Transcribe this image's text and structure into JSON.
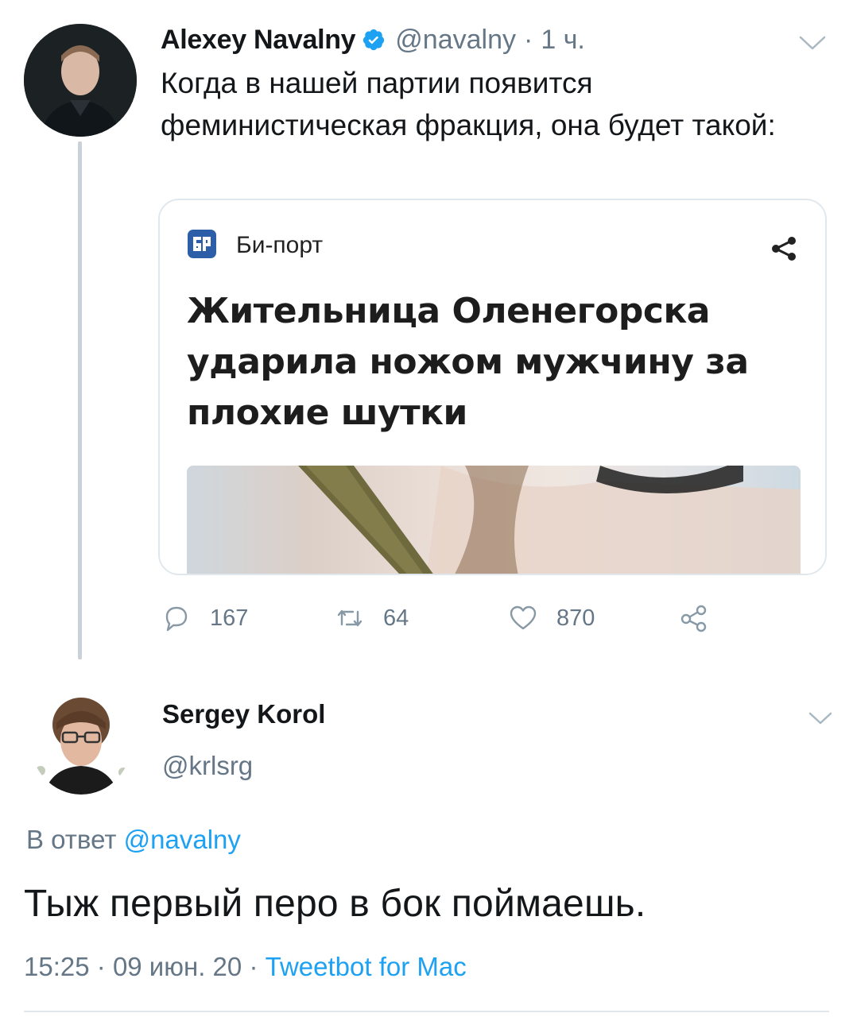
{
  "tweet": {
    "author_name": "Alexey Navalny",
    "author_handle": "@navalny",
    "separator": "·",
    "time_ago": "1 ч.",
    "text": "Когда в нашей партии появится феминистическая фракция, она будет такой:",
    "card": {
      "source": "Би-порт",
      "headline": "Жительница Оленегорска ударила ножом мужчину за плохие шутки"
    },
    "stats": {
      "replies": "167",
      "retweets": "64",
      "likes": "870"
    }
  },
  "reply": {
    "author_name": "Sergey Korol",
    "author_handle": "@krlsrg",
    "reply_prefix": "В ответ",
    "reply_to_handle": "@navalny",
    "text": "Тыж первый перо в бок поймаешь.",
    "time": "15:25",
    "separator": "·",
    "date": "09 июн. 20",
    "client": "Tweetbot for Mac"
  },
  "colors": {
    "accent": "#1da1f2",
    "secondary_text": "#657786",
    "primary_text": "#14171a",
    "thread_line": "#c9d2d9"
  },
  "icons": [
    "verified-badge-icon",
    "chevron-down-icon",
    "share-icon",
    "reply-icon",
    "retweet-icon",
    "like-icon",
    "share-nodes-icon",
    "biport-logo"
  ]
}
